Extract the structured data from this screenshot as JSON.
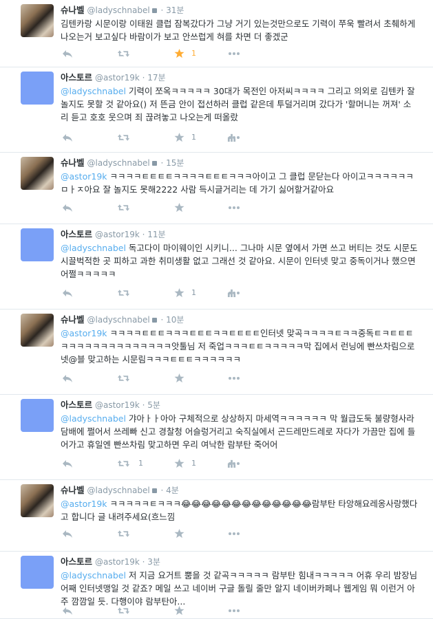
{
  "tweets": [
    {
      "name": "슈나벨",
      "handle": "@ladyschnabel",
      "time": "31분",
      "locked": true,
      "avatar": "photo",
      "text": [
        {
          "t": "김텐카랑 시문이랑 이태원 클럽 잠복갔다가 그냥 거기 있는것만으로도 기력이 쭈욱 빨려서 초췌하게 나오는거 보고싶다 바람이가 보고 안쓰럽게 혀를 차면 더 좋겠군",
          "m": false
        }
      ],
      "retweets": "",
      "favorites": "1",
      "favorited": true,
      "stats": false
    },
    {
      "name": "아스토르",
      "handle": "@astor19k",
      "time": "17분",
      "locked": false,
      "avatar": "blue",
      "text": [
        {
          "t": "@ladyschnabel",
          "m": true
        },
        {
          "t": " 기력이 쪼옥ㅋㅋㅋㅋㅋ 30대가 목전인 아저씨ㅋㅋㅋㅋ 그리고 의외로 김텐카 잘 놀지도 못할 것 같아요() 저 뜬금 안이 접선하러 클럽 같은데 투덜거리며 갔다가 '할머니는 꺼져' 소리 듣고 호호 웃으며 죄 끊려놓고 나오는게 떠올랐",
          "m": false
        }
      ],
      "retweets": "",
      "favorites": "1",
      "favorited": false,
      "stats": true
    },
    {
      "name": "슈나벨",
      "handle": "@ladyschnabel",
      "time": "15분",
      "locked": true,
      "avatar": "photo",
      "text": [
        {
          "t": "@astor19k",
          "m": true
        },
        {
          "t": " ㅋㅋㅋㅋㅌㅌㅌㅌㅋㅋㅋㅋㅌㅌㅌㅋㅋㅋ아이고 그 클럽 문닫는다 아이고ㅋㅋㅋㅋㅋㅋㅁㅏㅈ아요 잘 놀지도 못해2222 사람 득시글거리는 데 가기 싫어할거같아요",
          "m": false
        }
      ],
      "retweets": "",
      "favorites": "",
      "favorited": false,
      "stats": false
    },
    {
      "name": "아스토르",
      "handle": "@astor19k",
      "time": "11분",
      "locked": false,
      "avatar": "blue",
      "text": [
        {
          "t": "@ladyschnabel",
          "m": true
        },
        {
          "t": " 독고다이 마이웨이인 시키니... 그나마 시문 옆에서 가면 쓰고 버티는 것도 시문도 시끌벅적한 곳 피하고 과한 취미생활 없고 그래선 것 같아요. 시문이 인터넷 맞고 중독이거나 했으면 어쩔ㅋㅋㅋㅋㅋ",
          "m": false
        }
      ],
      "retweets": "",
      "favorites": "1",
      "favorited": false,
      "stats": true
    },
    {
      "name": "슈나벨",
      "handle": "@ladyschnabel",
      "time": "10분",
      "locked": true,
      "avatar": "photo",
      "text": [
        {
          "t": "@astor19k",
          "m": true
        },
        {
          "t": " ㅋㅋㅋㅋㅌㅌㅌㅋㅋㅋㅌㅌㅌㅋㅋㅌㅌㅌㅌ인터넷 맞곡ㅋㅋㅋㅋㅌㅋㅋ중독ㅌㅋㅌㅌㅌㅋㅋㅋㅋㅋㅋㅋㅋㅋㅋㅋㅋㅋㅋ앗툴님 저 죽업ㅋㅋㅋㅌㅌㅋㅋㅋㅋㅋ막 집에서 런닝에 빤쓰차림으로 넷@블 맞고하는 시문림ㅋㅋㅋㅌㅌㅌㅋㅋㅋㅋㅋㅋ",
          "m": false
        }
      ],
      "retweets": "",
      "favorites": "",
      "favorited": false,
      "stats": false
    },
    {
      "name": "아스토르",
      "handle": "@astor19k",
      "time": "5분",
      "locked": false,
      "avatar": "blue",
      "text": [
        {
          "t": "@ladyschnabel",
          "m": true
        },
        {
          "t": " 갸아ㅏㅏ아아 구체적으로 상상하지 마세역ㅋㅋㅋㅋㅋㅋ 막 월급도둑 불량형사라 담배에 쩔어서 쓰레빠 신고 경찰청 어슬렁거리고 숙직실에서 곤드레만드레로 자다가 가끔만 집에 들어가고 휴일엔 빤쓰차림 맞고하면 우리 여낙한 람부탄 죽어어",
          "m": false
        }
      ],
      "retweets": "1",
      "favorites": "1",
      "favorited": false,
      "stats": true
    },
    {
      "name": "슈나벨",
      "handle": "@ladyschnabel",
      "time": "4분",
      "locked": true,
      "avatar": "photo",
      "text": [
        {
          "t": "@astor19k",
          "m": true
        },
        {
          "t": " ㅋㅋㅋㅋㅋㅌㅋㅋㅋ😂😂😂😂😂😂😂😂😂😂😂😂😂람부탄 타앙해요레옹사랑했다고 합니다 글 내려주세요(흐느낌",
          "m": false
        }
      ],
      "retweets": "",
      "favorites": "",
      "favorited": false,
      "stats": false
    },
    {
      "name": "아스토르",
      "handle": "@astor19k",
      "time": "3분",
      "locked": false,
      "avatar": "blue",
      "text": [
        {
          "t": "@ladyschnabel",
          "m": true
        },
        {
          "t": " 저 지금 요거트 뿜을 것 같곡ㅋㅋㅋㅋㅋ 람부탄 힘내ㅋㅋㅋㅋㅋ 어휴 우리 밤장님 어째 인터넷맹일 것 같죠? 메일 쓰고 네이버 구글 돌릴 줄만 알지 네이버카페나 웹게임 뭐 이런거 아주 깜깜일 듯. 다행이야 람부탄아...",
          "m": false
        }
      ],
      "retweets": "",
      "favorites": "",
      "favorited": false,
      "stats": false
    }
  ],
  "icons": {
    "lock": "lock-icon",
    "reply": "reply-icon",
    "retweet": "retweet-icon",
    "favorite": "star-icon",
    "stats": "stats-icon",
    "more": "more-icon"
  },
  "colors": {
    "mention": "#55acee",
    "favorite_active": "#ffac33",
    "avatar_blue": "#7aa0f7",
    "action_gray": "#aab8c2",
    "handle_gray": "#8899a6"
  }
}
